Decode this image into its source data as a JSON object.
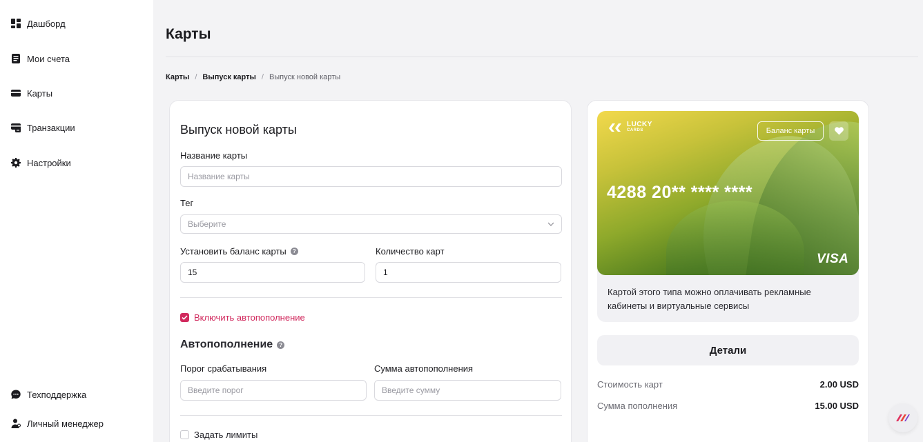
{
  "sidebar": {
    "items": [
      {
        "label": "Дашборд",
        "icon": "dashboard-icon"
      },
      {
        "label": "Мои счета",
        "icon": "accounts-icon"
      },
      {
        "label": "Карты",
        "icon": "card-icon"
      },
      {
        "label": "Транзакции",
        "icon": "transactions-icon"
      },
      {
        "label": "Настройки",
        "icon": "gear-icon"
      }
    ],
    "bottom_items": [
      {
        "label": "Техподдержка",
        "icon": "chat-icon"
      },
      {
        "label": "Личный менеджер",
        "icon": "user-icon"
      }
    ]
  },
  "header": {
    "title": "Карты"
  },
  "breadcrumb": {
    "items": [
      "Карты",
      "Выпуск карты"
    ],
    "current": "Выпуск новой карты",
    "separator": "/"
  },
  "form": {
    "heading": "Выпуск новой карты",
    "card_name": {
      "label": "Название карты",
      "placeholder": "Название карты",
      "value": ""
    },
    "tag": {
      "label": "Тег",
      "placeholder": "Выберите"
    },
    "balance": {
      "label": "Установить баланс карты",
      "value": "15"
    },
    "quantity": {
      "label": "Количество карт",
      "value": "1"
    },
    "autorefill_checkbox": {
      "label": "Включить автопополнение",
      "checked": true
    },
    "autorefill": {
      "heading": "Автопополнение",
      "threshold": {
        "label": "Порог срабатывания",
        "placeholder": "Введите порог"
      },
      "amount": {
        "label": "Сумма автопополнения",
        "placeholder": "Введите сумму"
      }
    },
    "limits_checkbox": {
      "label": "Задать лимиты",
      "checked": false
    }
  },
  "card_preview": {
    "brand_top": "LUCKY",
    "brand_bottom": "CARDS",
    "balance_button": "Баланс карты",
    "number": "4288 20** **** ****",
    "network": "VISA",
    "description": "Картой этого типа можно оплачивать рекламные кабинеты и виртуальные сервисы"
  },
  "details": {
    "button_label": "Детали",
    "rows": [
      {
        "label": "Стоимость карт",
        "value": "2.00 USD"
      },
      {
        "label": "Сумма пополнения",
        "value": "15.00 USD"
      }
    ]
  },
  "colors": {
    "accent": "#d12a5e",
    "background": "#f3f3f5",
    "card_gradient_top": "#f2d94c",
    "card_gradient_bottom": "#2f5a14"
  }
}
